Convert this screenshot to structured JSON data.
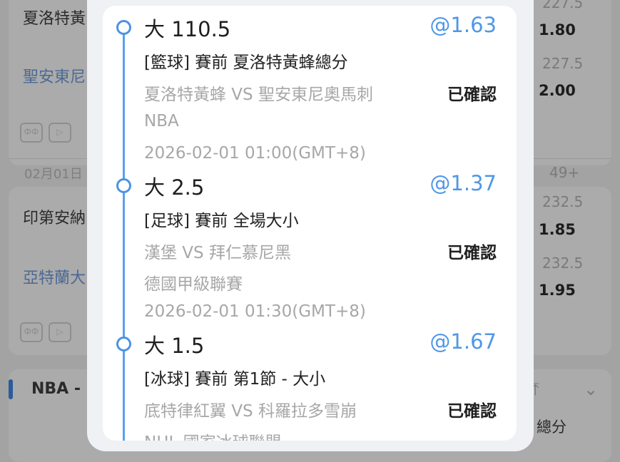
{
  "background": {
    "matches": [
      {
        "home": "夏洛特黃",
        "away": "聖安東尼",
        "lines": [
          "227.5",
          "227.5"
        ],
        "odds": [
          "1.80",
          "2.00"
        ]
      },
      {
        "home": "印第安納",
        "away": "亞特蘭大",
        "lines": [
          "232.5",
          "232.5"
        ],
        "odds": [
          "1.85",
          "1.95"
        ]
      }
    ],
    "date_label": "02月01日",
    "more_count": "49+",
    "section_title": "NBA -",
    "total_label": "總分",
    "icon_a": "ФФ",
    "icon_b": "▷"
  },
  "bets": [
    {
      "pick": "大 110.5",
      "odds": "@1.63",
      "market": "[籃球] 賽前 夏洛特黃蜂總分",
      "match": "夏洛特黃蜂 VS 聖安東尼奧馬刺",
      "status": "已確認",
      "league": "NBA",
      "time": "2026-02-01 01:00(GMT+8)"
    },
    {
      "pick": "大 2.5",
      "odds": "@1.37",
      "market": "[足球] 賽前 全場大小",
      "match": "漢堡 VS 拜仁慕尼黑",
      "status": "已確認",
      "league": "德國甲級聯賽",
      "time": "2026-02-01 01:30(GMT+8)"
    },
    {
      "pick": "大 1.5",
      "odds": "@1.67",
      "market": "[冰球] 賽前 第1節 - 大小",
      "match": "底特律紅翼 VS 科羅拉多雪崩",
      "status": "已確認",
      "league": "NHL 國家冰球聯盟",
      "time": ""
    }
  ],
  "colors": {
    "accent": "#4f97e8",
    "timeline": "#5ba0ea",
    "muted_text": "#a7a7a7"
  }
}
